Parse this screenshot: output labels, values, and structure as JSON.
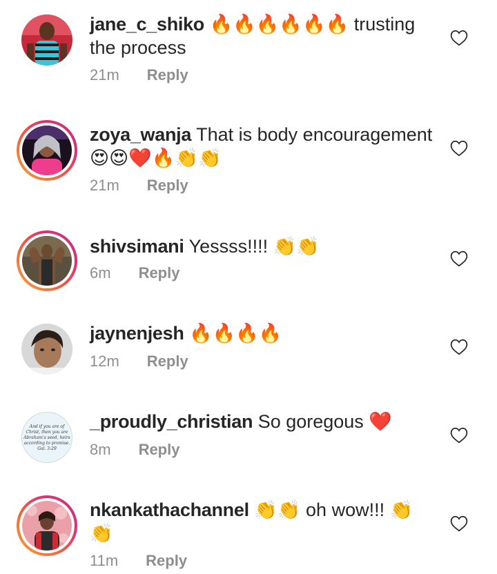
{
  "comments": [
    {
      "username": "jane_c_shiko",
      "text": "🔥🔥🔥🔥🔥🔥 trusting the process",
      "time": "21m",
      "reply": "Reply",
      "has_story_ring": false
    },
    {
      "username": "zoya_wanja",
      "text": "That is body encouragement 😍😍❤️🔥👏👏",
      "time": "21m",
      "reply": "Reply",
      "has_story_ring": true
    },
    {
      "username": "shivsimani",
      "text": "Yessss!!!! 👏👏",
      "time": "6m",
      "reply": "Reply",
      "has_story_ring": true
    },
    {
      "username": "jaynenjesh",
      "text": "🔥🔥🔥🔥",
      "time": "12m",
      "reply": "Reply",
      "has_story_ring": false
    },
    {
      "username": "_proudly_christian",
      "text": "So goregous ❤️",
      "time": "8m",
      "reply": "Reply",
      "has_story_ring": false,
      "avatar_caption": "And if you are of Christ, then you are Abraham's seed, heirs according to promise. Gal. 3:29"
    },
    {
      "username": "nkankathachannel",
      "text": "👏👏 oh wow!!! 👏👏",
      "time": "11m",
      "reply": "Reply",
      "has_story_ring": true
    }
  ],
  "icons": {
    "like": "heart-outline-icon"
  },
  "colors": {
    "text": "#262626",
    "meta": "#8e8e8e",
    "story_ring_start": "#f7a43a",
    "story_ring_end": "#c13584"
  }
}
